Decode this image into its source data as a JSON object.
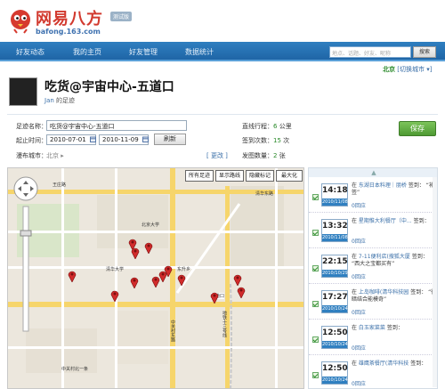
{
  "brand": {
    "name": "网易八方",
    "url": "bafong.163.com",
    "badge": "测试版"
  },
  "nav": {
    "items": [
      {
        "label": "好友动态"
      },
      {
        "label": "我的主页"
      },
      {
        "label": "好友管理"
      },
      {
        "label": "数据统计"
      }
    ],
    "search_placeholder": "地点、话题、好友、昵称",
    "search_button": "搜索"
  },
  "city": {
    "name": "北京",
    "switch_label": "[切换城市 ▾]"
  },
  "place": {
    "title": "吃货@宇宙中心-五道口",
    "author": "Jan",
    "author_suffix": "的足迹"
  },
  "form": {
    "name_label": "足迹名称：",
    "name_value": "吃货@宇宙中心-五道口",
    "time_label": "起止时间：",
    "start_date": "2010-07-01",
    "end_date": "2010-11-09",
    "refresh_button": "刷新",
    "city_label": "漫布城市：",
    "city_value": "北京 ▸",
    "change_link": "[ 更改 ]",
    "save_button": "保存"
  },
  "stats": {
    "distance_label": "直线行程：",
    "distance_value": "6",
    "distance_unit": "公里",
    "checkins_label": "签到次数：",
    "checkins_value": "15",
    "checkins_unit": "次",
    "photos_label": "发图数量：",
    "photos_value": "2",
    "photos_unit": "张"
  },
  "map": {
    "buttons": {
      "all": "所有足迹",
      "route": "显示路线",
      "hide": "隐藏标记",
      "max": "最大化"
    },
    "labels": [
      "清华大学",
      "中关村北大街",
      "东升乡",
      "五道口",
      "清华东路",
      "地铁十三号线",
      "中关村东路",
      "学院路",
      "成府路",
      "北京大学",
      "王庄路",
      "中关村北一条"
    ],
    "marker_count": 13
  },
  "checkins": {
    "top_arrow": "▲",
    "items": [
      {
        "time": "14:18",
        "date": "2010/11/08",
        "place": "东湖日本料理｜朋桥",
        "note": "“补签”",
        "replies": "0回应"
      },
      {
        "time": "13:32",
        "date": "2010/11/08",
        "place": "星期惟大利餐厅（中...",
        "note": "",
        "replies": "0回应"
      },
      {
        "time": "22:15",
        "date": "2010/10/29",
        "place": "7-11便利店(搜狐大厦",
        "note": "“西大之宝都买有”",
        "replies": "0回应"
      },
      {
        "time": "17:27",
        "date": "2010/10/24",
        "place": "上岛咖啡(清华科技园",
        "note": "“微暗结合能模奇”",
        "replies": "0回应"
      },
      {
        "time": "12:50",
        "date": "2010/10/24",
        "place": "白玉家菜菜",
        "note": "",
        "replies": "0回应"
      },
      {
        "time": "12:50",
        "date": "2010/10/24",
        "place": "雄鹰茶餐厅(清华科技",
        "note": "",
        "replies": "0回应"
      }
    ],
    "signed_label": "签到："
  }
}
